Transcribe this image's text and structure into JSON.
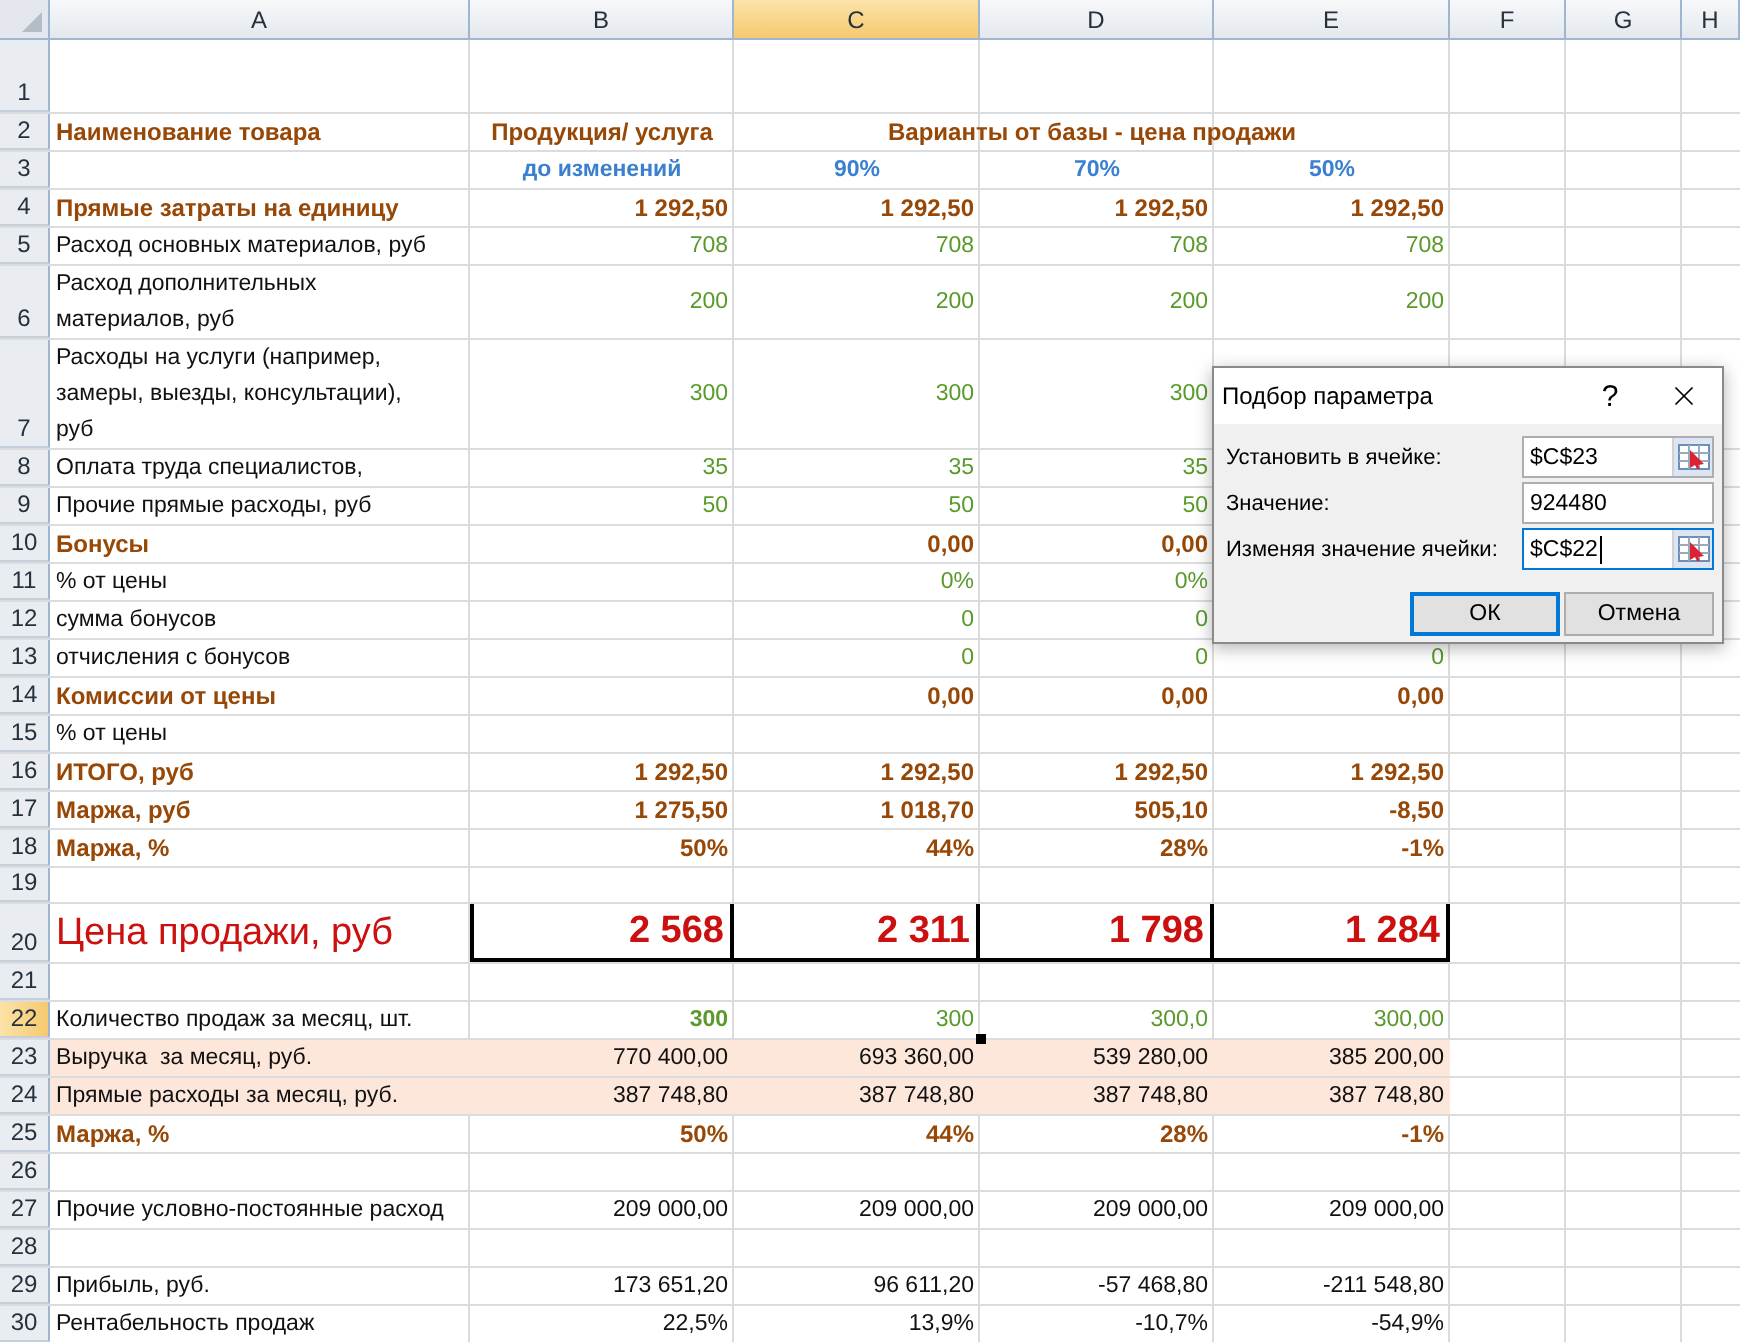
{
  "columns": [
    {
      "letter": "A",
      "selected": false
    },
    {
      "letter": "B",
      "selected": false
    },
    {
      "letter": "C",
      "selected": true
    },
    {
      "letter": "D",
      "selected": false
    },
    {
      "letter": "E",
      "selected": false
    },
    {
      "letter": "F",
      "selected": false
    },
    {
      "letter": "G",
      "selected": false
    },
    {
      "letter": "H",
      "selected": false
    }
  ],
  "rows": [
    {
      "number": "1",
      "kind": "spacer",
      "selected": false
    },
    {
      "number": "2",
      "kind": "header",
      "selected": false,
      "cells": [
        "Наименование товара",
        "Продукция/ услуга",
        "Варианты от базы - цена продажи"
      ]
    },
    {
      "number": "3",
      "kind": "subheader",
      "selected": false,
      "cells": [
        null,
        "до изменений",
        "90%",
        "70%",
        "50%"
      ]
    },
    {
      "number": "4",
      "kind": "section",
      "selected": false,
      "cells": [
        "Прямые затраты на единицу",
        "1 292,50",
        "1 292,50",
        "1 292,50",
        "1 292,50"
      ]
    },
    {
      "number": "5",
      "kind": "input",
      "selected": false,
      "cells": [
        "Расход основных материалов, руб",
        "708",
        "708",
        "708",
        "708"
      ]
    },
    {
      "number": "6",
      "kind": "input",
      "selected": false,
      "cells": [
        "Расход дополнительных материалов, руб",
        "200",
        "200",
        "200",
        "200"
      ]
    },
    {
      "number": "7",
      "kind": "input",
      "selected": false,
      "cells": [
        "Расходы на услуги (например, замеры, выезды, консультации), руб",
        "300",
        "300",
        "300",
        null
      ]
    },
    {
      "number": "8",
      "kind": "input",
      "selected": false,
      "cells": [
        "Оплата труда специалистов,",
        "35",
        "35",
        "35",
        null
      ]
    },
    {
      "number": "9",
      "kind": "input",
      "selected": false,
      "cells": [
        "Прочие прямые расходы, руб",
        "50",
        "50",
        "50",
        null
      ]
    },
    {
      "number": "10",
      "kind": "section",
      "selected": false,
      "cells": [
        "Бонусы",
        null,
        "0,00",
        "0,00",
        null
      ]
    },
    {
      "number": "11",
      "kind": "input",
      "selected": false,
      "cells": [
        "% от цены",
        null,
        "0%",
        "0%",
        null
      ]
    },
    {
      "number": "12",
      "kind": "input",
      "selected": false,
      "cells": [
        "сумма бонусов",
        null,
        "0",
        "0",
        null
      ]
    },
    {
      "number": "13",
      "kind": "input",
      "selected": false,
      "cells": [
        "отчисления с бонусов",
        null,
        "0",
        "0",
        "0"
      ]
    },
    {
      "number": "14",
      "kind": "section",
      "selected": false,
      "cells": [
        "Комиссии от цены",
        null,
        "0,00",
        "0,00",
        "0,00"
      ]
    },
    {
      "number": "15",
      "kind": "plain",
      "selected": false,
      "cells": [
        "% от цены"
      ]
    },
    {
      "number": "16",
      "kind": "section",
      "selected": false,
      "cells": [
        "ИТОГО, руб",
        "1 292,50",
        "1 292,50",
        "1 292,50",
        "1 292,50"
      ]
    },
    {
      "number": "17",
      "kind": "section",
      "selected": false,
      "cells": [
        "Маржа, руб",
        "1 275,50",
        "1 018,70",
        "505,10",
        "-8,50"
      ]
    },
    {
      "number": "18",
      "kind": "section",
      "selected": false,
      "cells": [
        "Маржа, %",
        "50%",
        "44%",
        "28%",
        "-1%"
      ]
    },
    {
      "number": "19",
      "kind": "gap",
      "selected": false
    },
    {
      "number": "20",
      "kind": "price",
      "selected": false,
      "cells": [
        "Цена продажи, руб",
        "2 568",
        "2 311",
        "1 798",
        "1 284"
      ]
    },
    {
      "number": "21",
      "kind": "plain",
      "selected": false
    },
    {
      "number": "22",
      "kind": "input",
      "selected": true,
      "cells": [
        "Количество продаж за месяц, шт.",
        "300",
        "300",
        "300,0",
        "300,00"
      ]
    },
    {
      "number": "23",
      "kind": "revenue",
      "selected": false,
      "cells": [
        "Выручка  за месяц, руб.",
        "770 400,00",
        "693 360,00",
        "539 280,00",
        "385 200,00"
      ]
    },
    {
      "number": "24",
      "kind": "revenue",
      "selected": false,
      "cells": [
        "Прямые расходы за месяц, руб.",
        "387 748,80",
        "387 748,80",
        "387 748,80",
        "387 748,80"
      ]
    },
    {
      "number": "25",
      "kind": "section",
      "selected": false,
      "cells": [
        "Маржа, %",
        "50%",
        "44%",
        "28%",
        "-1%"
      ]
    },
    {
      "number": "26",
      "kind": "plain",
      "selected": false
    },
    {
      "number": "27",
      "kind": "plain",
      "selected": false,
      "cells": [
        "Прочие условно-постоянные расход",
        "209 000,00",
        "209 000,00",
        "209 000,00",
        "209 000,00"
      ]
    },
    {
      "number": "28",
      "kind": "plain",
      "selected": false
    },
    {
      "number": "29",
      "kind": "plain",
      "selected": false,
      "cells": [
        "Прибыль, руб.",
        "173 651,20",
        "96 611,20",
        "-57 468,80",
        "-211 548,80"
      ]
    },
    {
      "number": "30",
      "kind": "plain",
      "selected": false,
      "cells": [
        "Рентабельность продаж",
        "22,5%",
        "13,9%",
        "-10,7%",
        "-54,9%"
      ]
    }
  ],
  "dialog": {
    "title": "Подбор параметра",
    "help": "?",
    "fields": [
      {
        "label": "Установить в ячейке:",
        "value": "$C$23",
        "picker": true,
        "focused": false
      },
      {
        "label": "Значение:",
        "value": "924480",
        "picker": false,
        "focused": false
      },
      {
        "label": "Изменяя значение ячейки:",
        "value": "$C$22",
        "picker": true,
        "focused": true
      }
    ],
    "buttons": [
      {
        "label": "ОК",
        "default": true
      },
      {
        "label": "Отмена",
        "default": false
      }
    ]
  }
}
